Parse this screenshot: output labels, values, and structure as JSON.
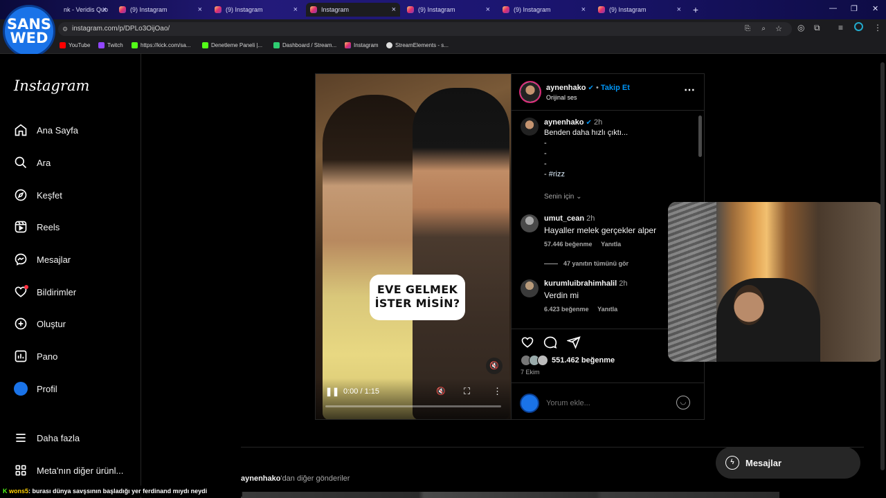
{
  "browser": {
    "tabs": [
      {
        "label": "nk - Veridis Quo",
        "active": false
      },
      {
        "label": "(9) Instagram",
        "active": false
      },
      {
        "label": "(9) Instagram",
        "active": false
      },
      {
        "label": "Instagram",
        "active": true
      },
      {
        "label": "(9) Instagram",
        "active": false
      },
      {
        "label": "(9) Instagram",
        "active": false
      },
      {
        "label": "(9) Instagram",
        "active": false
      }
    ],
    "url": "instagram.com/p/DPLo3OijOao/",
    "bookmarks": [
      "YouTube",
      "Twitch",
      "https://kick.com/sa...",
      "Denetleme Paneli |...",
      "Dashboard / Stream...",
      "Instagram",
      "StreamElements - s..."
    ],
    "channel_logo_line1": "SANS",
    "channel_logo_line2": "WED"
  },
  "sidebar": {
    "logo": "Instagram",
    "items": [
      {
        "label": "Ana Sayfa",
        "icon": "home-icon"
      },
      {
        "label": "Ara",
        "icon": "search-icon"
      },
      {
        "label": "Keşfet",
        "icon": "compass-icon"
      },
      {
        "label": "Reels",
        "icon": "reels-icon"
      },
      {
        "label": "Mesajlar",
        "icon": "messenger-icon"
      },
      {
        "label": "Bildirimler",
        "icon": "heart-icon"
      },
      {
        "label": "Oluştur",
        "icon": "plus-square-icon"
      },
      {
        "label": "Pano",
        "icon": "dashboard-icon"
      },
      {
        "label": "Profil",
        "icon": "profile-avatar-icon"
      }
    ],
    "more": "Daha fazla",
    "meta": "Meta'nın diğer ürünl..."
  },
  "post": {
    "username": "aynenhako",
    "follow": "Takip Et",
    "follow_dot": "•",
    "audio": "Orijinal ses",
    "sticker_line1": "EVE GELMEK",
    "sticker_line2": "İSTER MİSİN?",
    "time_display": "0:00 / 1:15",
    "progress": 0,
    "caption": {
      "username": "aynenhako",
      "age": "2h",
      "text": "Benden daha hızlı çıktı...",
      "dashes": [
        "-",
        "-",
        "-"
      ],
      "tag_prefix": "- ",
      "hashtag": "#rizz"
    },
    "for_you": "Senin için",
    "comments": [
      {
        "username": "umut_cean",
        "age": "2h",
        "text": "Hayaller melek gerçekler alper",
        "likes": "57.446 beğenme",
        "reply": "Yanıtla",
        "view_replies": "47 yanıtın tümünü gör"
      },
      {
        "username": "kurumluibrahimhalil",
        "age": "2h",
        "text": "Verdin mi",
        "likes": "6.423 beğenme",
        "reply": "Yanıtla"
      }
    ],
    "like_count": "551.462 beğenme",
    "date": "7 Ekim",
    "comment_placeholder": "Yorum ekle..."
  },
  "more_posts": {
    "username": "aynenhako",
    "suffix": "'dan diğer gönderiler"
  },
  "messages_button": "Mesajlar",
  "chat_overlay": {
    "user": "wons5",
    "text": ": burası dünya savşsının başladığı yer ferdinand mıydı neydi"
  },
  "colors": {
    "link_blue": "#0095f6",
    "background": "#000000",
    "hashtag": "#e0f1ff"
  }
}
